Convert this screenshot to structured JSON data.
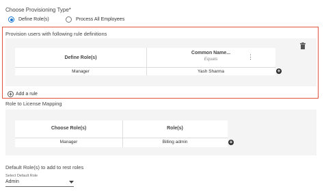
{
  "provisioning": {
    "title": "Choose Provisioning Type*",
    "options": [
      {
        "label": "Define Role(s)",
        "selected": true
      },
      {
        "label": "Process All Employees",
        "selected": false
      }
    ]
  },
  "rules": {
    "section_title": "Provision users with following rule definitions",
    "columns": [
      "Define Role(s)",
      "Common Name..."
    ],
    "operator": "Equals",
    "row": [
      "Manager",
      "Yash Sharma"
    ],
    "add_rule_label": "Add a rule"
  },
  "license": {
    "section_title": "Role to License Mapping",
    "columns": [
      "Choose Role(s)",
      "Role(s)"
    ],
    "row": [
      "Manager",
      "Billing admin"
    ]
  },
  "default_roles": {
    "section_title": "Default Role(s) to add to rest roles",
    "select_label": "Select Default Role",
    "select_value": "Admin"
  },
  "colors": {
    "accent": "#1976d2",
    "highlight_border": "#e0523a"
  },
  "icons": {
    "more": "more-vert-icon",
    "delete": "trash-icon",
    "add": "add-circle-icon",
    "dropdown": "caret-down-icon"
  }
}
